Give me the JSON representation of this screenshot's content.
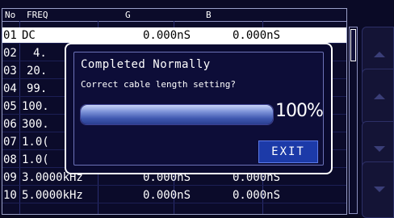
{
  "table": {
    "headers": {
      "no": "No",
      "freq": "FREQ",
      "g": "G",
      "b": "B"
    },
    "rows": [
      {
        "no": "01",
        "freq": "DC",
        "g": "0.000nS",
        "b": "0.000nS",
        "selected": true
      },
      {
        "no": "02",
        "freq": "4.",
        "g": "",
        "b": ""
      },
      {
        "no": "03",
        "freq": "20.",
        "g": "",
        "b": ""
      },
      {
        "no": "04",
        "freq": "99.",
        "g": "",
        "b": ""
      },
      {
        "no": "05",
        "freq": "100.",
        "g": "",
        "b": ""
      },
      {
        "no": "06",
        "freq": "300.",
        "g": "",
        "b": ""
      },
      {
        "no": "07",
        "freq": "1.0(",
        "g": "",
        "b": ""
      },
      {
        "no": "08",
        "freq": "1.0(",
        "g": "",
        "b": ""
      },
      {
        "no": "09",
        "freq": "3.0000kHz",
        "g": "0.000nS",
        "b": "0.000nS"
      },
      {
        "no": "10",
        "freq": "5.0000kHz",
        "g": "0.000nS",
        "b": "0.000nS"
      }
    ]
  },
  "dialog": {
    "title": "Completed Normally",
    "message": "Correct cable length setting?",
    "progress_percent": 100,
    "progress_label": "100%",
    "exit_label": "EXIT"
  },
  "side_buttons": [
    {
      "icon": "arrow-up-icon"
    },
    {
      "icon": "arrow-up-icon"
    },
    {
      "icon": "arrow-down-icon"
    },
    {
      "icon": "arrow-down-icon"
    }
  ],
  "colors": {
    "background": "#0a0a26",
    "selected_row": "#ffffff",
    "exit_button": "#1c3aa8",
    "progress_fill": "#3f58b0"
  }
}
